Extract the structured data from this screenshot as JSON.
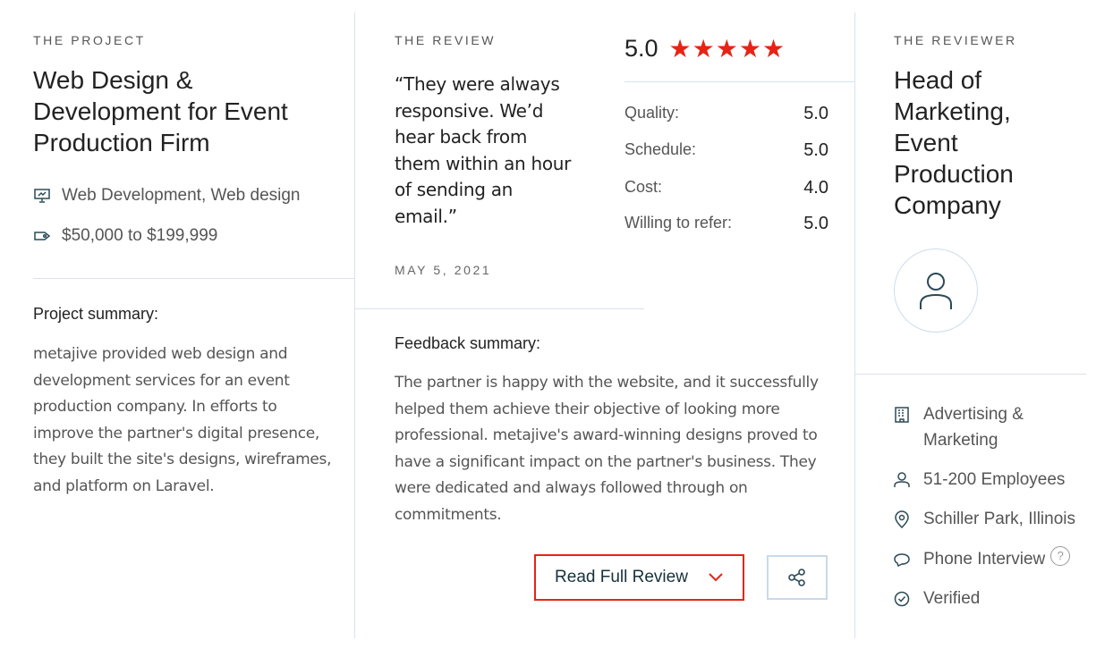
{
  "project": {
    "eyebrow": "THE PROJECT",
    "title": "Web Design & Development for Event Production Firm",
    "service": "Web Development, Web design",
    "budget": "$50,000 to $199,999",
    "summary_label": "Project summary:",
    "summary": "metajive provided web design and development services for an event production company. In efforts to improve the partner's digital presence, they built the site's designs, wireframes, and platform on Laravel."
  },
  "review": {
    "eyebrow": "THE REVIEW",
    "quote": "“They were always responsive. We’d hear back from them within an hour of sending an email.”",
    "date": "MAY 5, 2021",
    "overall": "5.0",
    "stars": "★★★★★",
    "scores": [
      {
        "label": "Quality:",
        "value": "5.0"
      },
      {
        "label": "Schedule:",
        "value": "5.0"
      },
      {
        "label": "Cost:",
        "value": "4.0"
      },
      {
        "label": "Willing to refer:",
        "value": "5.0"
      }
    ],
    "feedback_label": "Feedback summary:",
    "feedback": "The partner is happy with the website, and it successfully helped them achieve their objective of looking more professional. metajive's award-winning designs proved to have a significant impact on the partner's business. They were dedicated and always followed through on commitments.",
    "read_button": "Read Full Review"
  },
  "reviewer": {
    "eyebrow": "THE REVIEWER",
    "title": "Head of Marketing, Event Production Company",
    "industry": "Advertising & Marketing",
    "employees": "51-200 Employees",
    "location": "Schiller Park, Illinois",
    "interview": "Phone Interview",
    "help": "?",
    "verified": "Verified"
  },
  "colors": {
    "accent": "#e62415",
    "divider": "#d7e3ee"
  }
}
